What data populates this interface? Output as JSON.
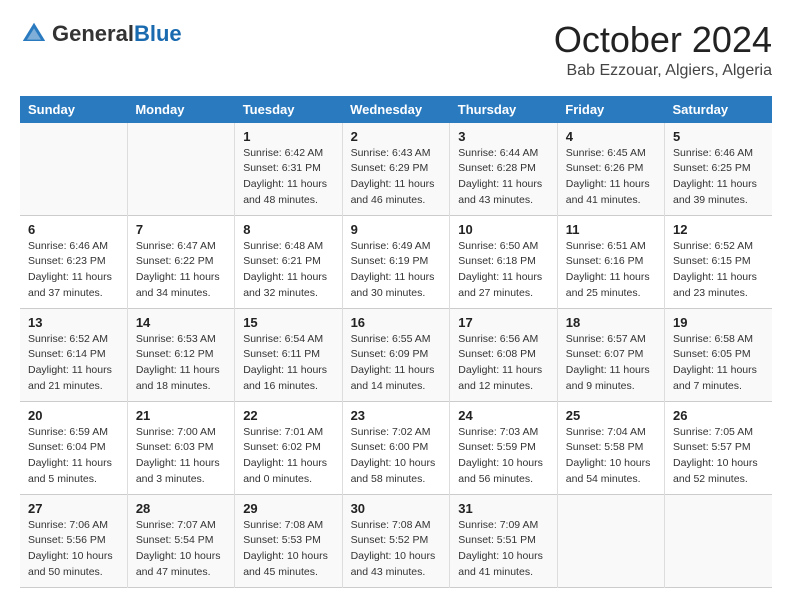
{
  "header": {
    "logo_general": "General",
    "logo_blue": "Blue",
    "title": "October 2024",
    "subtitle": "Bab Ezzouar, Algiers, Algeria"
  },
  "days_of_week": [
    "Sunday",
    "Monday",
    "Tuesday",
    "Wednesday",
    "Thursday",
    "Friday",
    "Saturday"
  ],
  "weeks": [
    [
      {
        "day": "",
        "info": ""
      },
      {
        "day": "",
        "info": ""
      },
      {
        "day": "1",
        "info": "Sunrise: 6:42 AM\nSunset: 6:31 PM\nDaylight: 11 hours and 48 minutes."
      },
      {
        "day": "2",
        "info": "Sunrise: 6:43 AM\nSunset: 6:29 PM\nDaylight: 11 hours and 46 minutes."
      },
      {
        "day": "3",
        "info": "Sunrise: 6:44 AM\nSunset: 6:28 PM\nDaylight: 11 hours and 43 minutes."
      },
      {
        "day": "4",
        "info": "Sunrise: 6:45 AM\nSunset: 6:26 PM\nDaylight: 11 hours and 41 minutes."
      },
      {
        "day": "5",
        "info": "Sunrise: 6:46 AM\nSunset: 6:25 PM\nDaylight: 11 hours and 39 minutes."
      }
    ],
    [
      {
        "day": "6",
        "info": "Sunrise: 6:46 AM\nSunset: 6:23 PM\nDaylight: 11 hours and 37 minutes."
      },
      {
        "day": "7",
        "info": "Sunrise: 6:47 AM\nSunset: 6:22 PM\nDaylight: 11 hours and 34 minutes."
      },
      {
        "day": "8",
        "info": "Sunrise: 6:48 AM\nSunset: 6:21 PM\nDaylight: 11 hours and 32 minutes."
      },
      {
        "day": "9",
        "info": "Sunrise: 6:49 AM\nSunset: 6:19 PM\nDaylight: 11 hours and 30 minutes."
      },
      {
        "day": "10",
        "info": "Sunrise: 6:50 AM\nSunset: 6:18 PM\nDaylight: 11 hours and 27 minutes."
      },
      {
        "day": "11",
        "info": "Sunrise: 6:51 AM\nSunset: 6:16 PM\nDaylight: 11 hours and 25 minutes."
      },
      {
        "day": "12",
        "info": "Sunrise: 6:52 AM\nSunset: 6:15 PM\nDaylight: 11 hours and 23 minutes."
      }
    ],
    [
      {
        "day": "13",
        "info": "Sunrise: 6:52 AM\nSunset: 6:14 PM\nDaylight: 11 hours and 21 minutes."
      },
      {
        "day": "14",
        "info": "Sunrise: 6:53 AM\nSunset: 6:12 PM\nDaylight: 11 hours and 18 minutes."
      },
      {
        "day": "15",
        "info": "Sunrise: 6:54 AM\nSunset: 6:11 PM\nDaylight: 11 hours and 16 minutes."
      },
      {
        "day": "16",
        "info": "Sunrise: 6:55 AM\nSunset: 6:09 PM\nDaylight: 11 hours and 14 minutes."
      },
      {
        "day": "17",
        "info": "Sunrise: 6:56 AM\nSunset: 6:08 PM\nDaylight: 11 hours and 12 minutes."
      },
      {
        "day": "18",
        "info": "Sunrise: 6:57 AM\nSunset: 6:07 PM\nDaylight: 11 hours and 9 minutes."
      },
      {
        "day": "19",
        "info": "Sunrise: 6:58 AM\nSunset: 6:05 PM\nDaylight: 11 hours and 7 minutes."
      }
    ],
    [
      {
        "day": "20",
        "info": "Sunrise: 6:59 AM\nSunset: 6:04 PM\nDaylight: 11 hours and 5 minutes."
      },
      {
        "day": "21",
        "info": "Sunrise: 7:00 AM\nSunset: 6:03 PM\nDaylight: 11 hours and 3 minutes."
      },
      {
        "day": "22",
        "info": "Sunrise: 7:01 AM\nSunset: 6:02 PM\nDaylight: 11 hours and 0 minutes."
      },
      {
        "day": "23",
        "info": "Sunrise: 7:02 AM\nSunset: 6:00 PM\nDaylight: 10 hours and 58 minutes."
      },
      {
        "day": "24",
        "info": "Sunrise: 7:03 AM\nSunset: 5:59 PM\nDaylight: 10 hours and 56 minutes."
      },
      {
        "day": "25",
        "info": "Sunrise: 7:04 AM\nSunset: 5:58 PM\nDaylight: 10 hours and 54 minutes."
      },
      {
        "day": "26",
        "info": "Sunrise: 7:05 AM\nSunset: 5:57 PM\nDaylight: 10 hours and 52 minutes."
      }
    ],
    [
      {
        "day": "27",
        "info": "Sunrise: 7:06 AM\nSunset: 5:56 PM\nDaylight: 10 hours and 50 minutes."
      },
      {
        "day": "28",
        "info": "Sunrise: 7:07 AM\nSunset: 5:54 PM\nDaylight: 10 hours and 47 minutes."
      },
      {
        "day": "29",
        "info": "Sunrise: 7:08 AM\nSunset: 5:53 PM\nDaylight: 10 hours and 45 minutes."
      },
      {
        "day": "30",
        "info": "Sunrise: 7:08 AM\nSunset: 5:52 PM\nDaylight: 10 hours and 43 minutes."
      },
      {
        "day": "31",
        "info": "Sunrise: 7:09 AM\nSunset: 5:51 PM\nDaylight: 10 hours and 41 minutes."
      },
      {
        "day": "",
        "info": ""
      },
      {
        "day": "",
        "info": ""
      }
    ]
  ]
}
